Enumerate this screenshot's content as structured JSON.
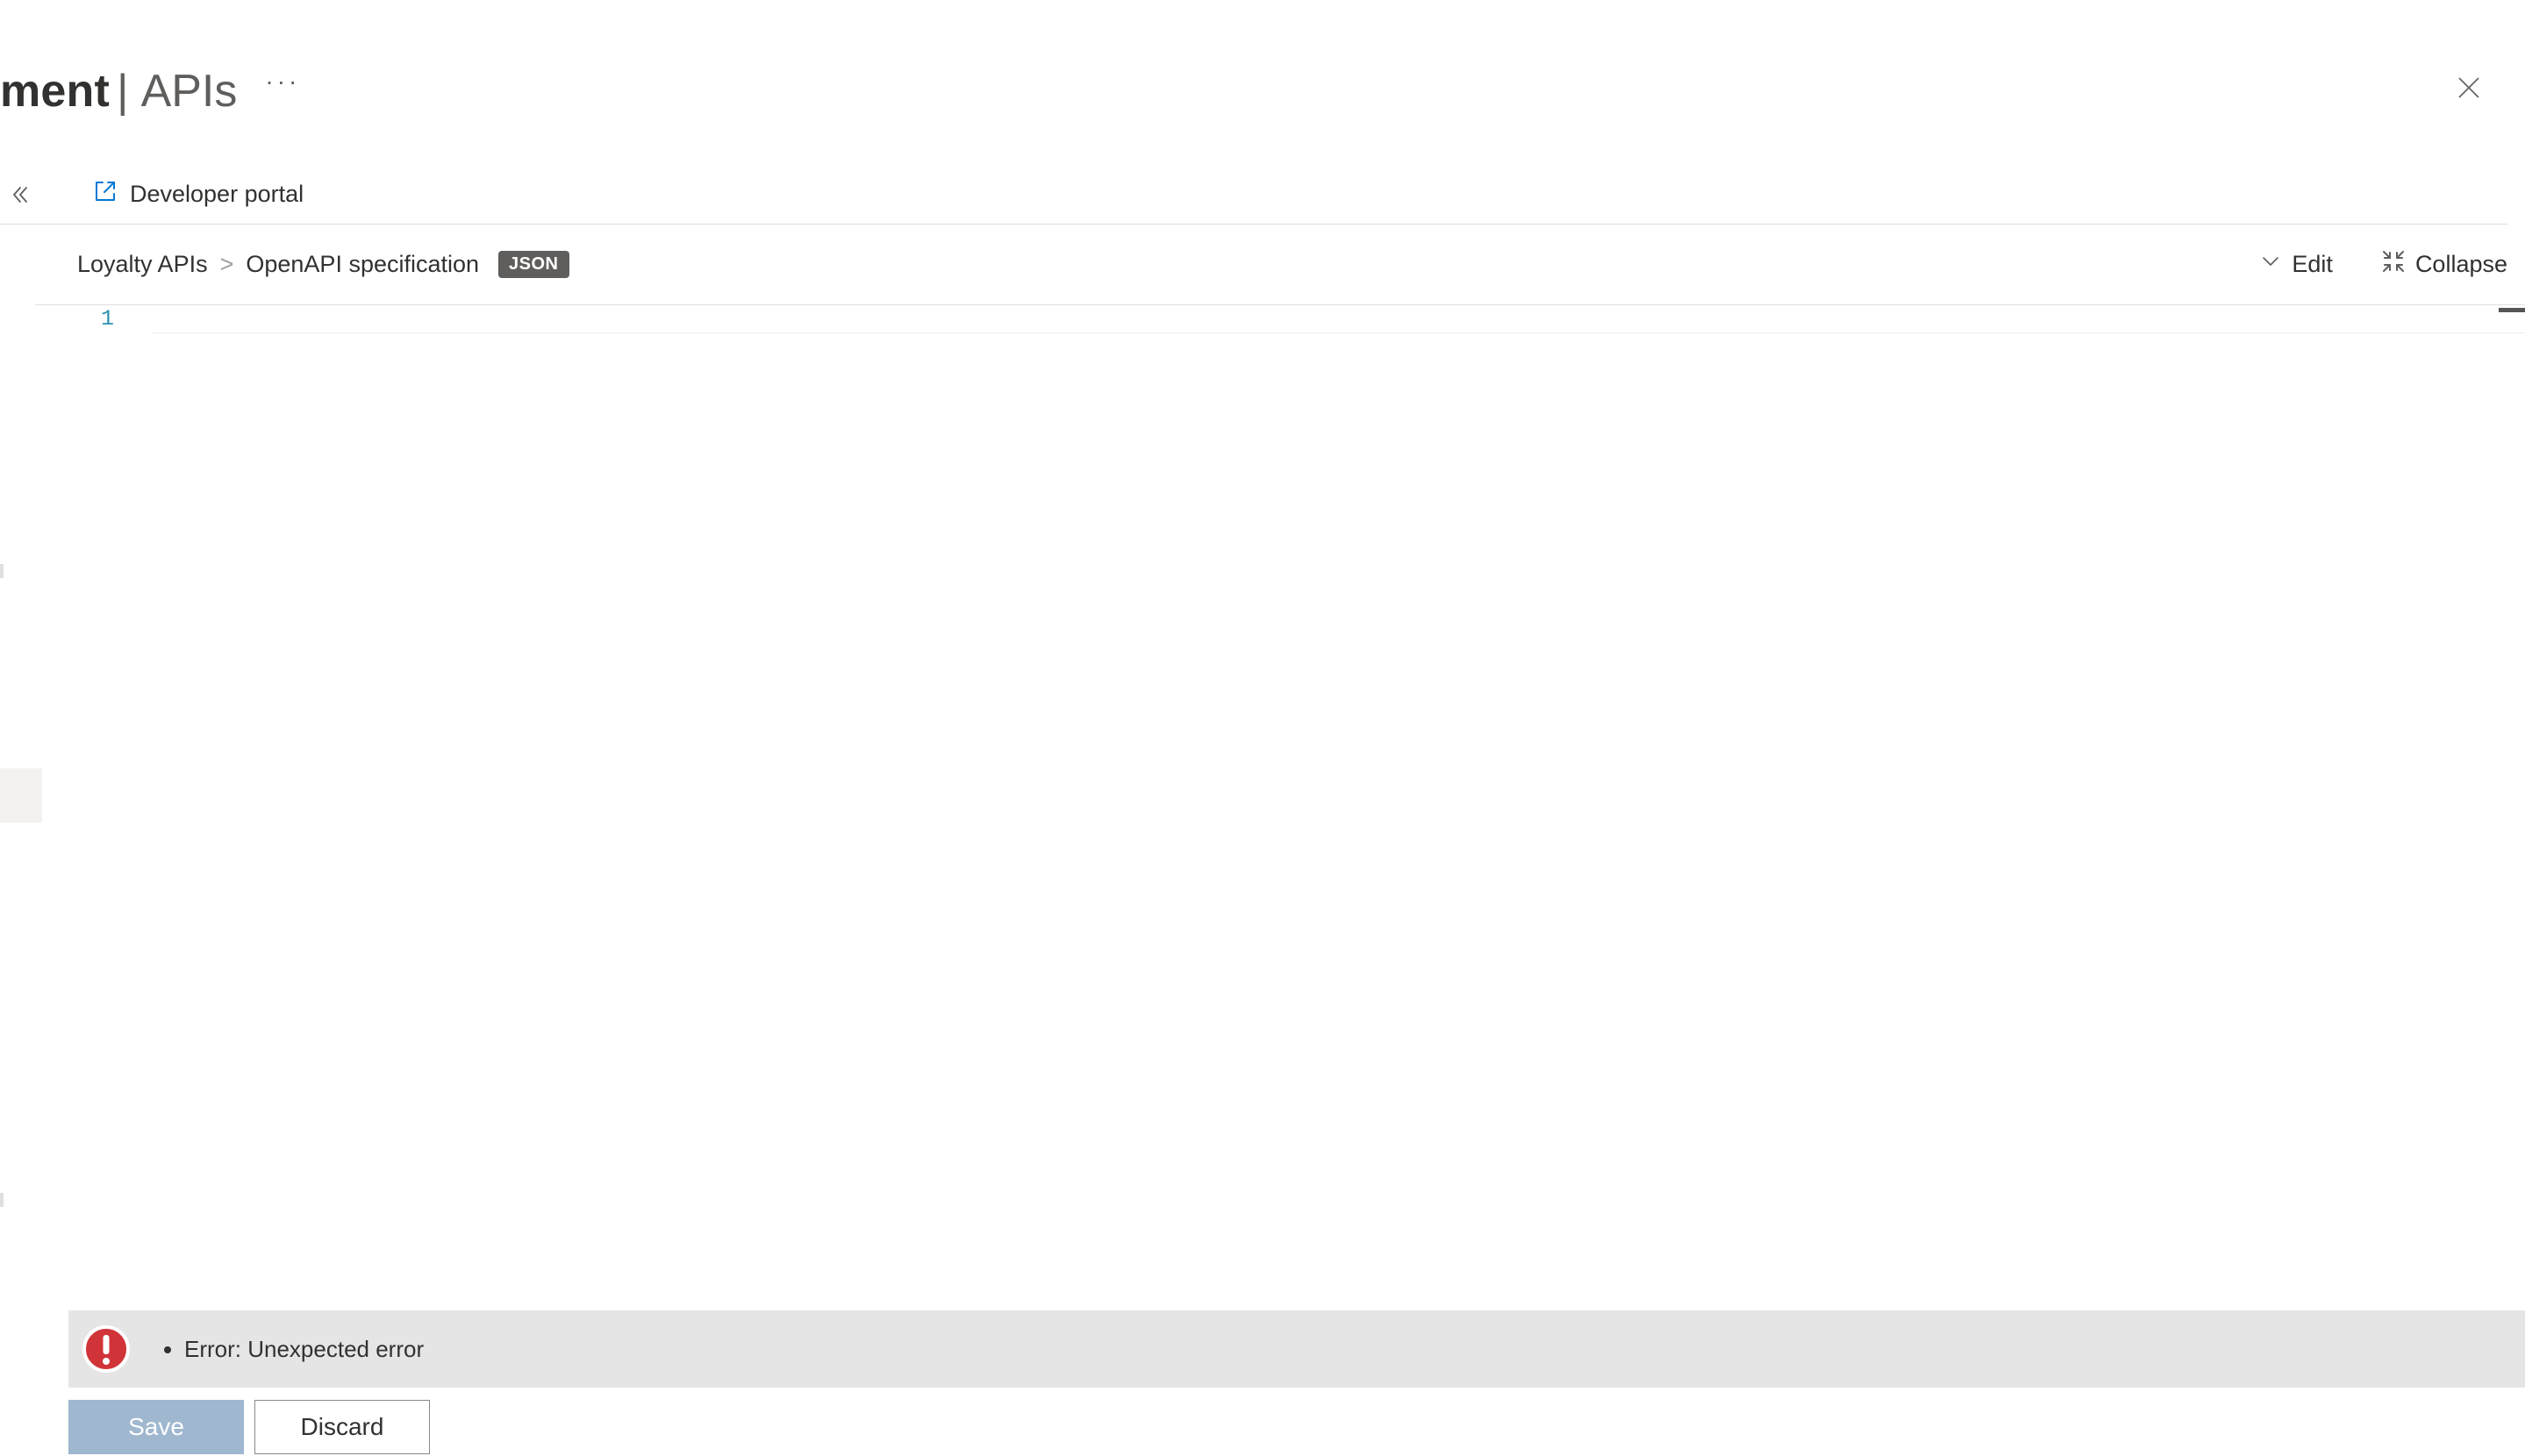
{
  "header": {
    "title_partial": "ment",
    "title_separator": "|",
    "title_section": "APIs"
  },
  "toolbar": {
    "developer_portal_label": "Developer portal"
  },
  "breadcrumb": {
    "root": "Loyalty APIs",
    "current": "OpenAPI specification",
    "badge": "JSON"
  },
  "actions": {
    "edit_label": "Edit",
    "collapse_label": "Collapse"
  },
  "editor": {
    "line_number": "1",
    "line_content": ""
  },
  "error": {
    "message": "Error: Unexpected error"
  },
  "buttons": {
    "save_label": "Save",
    "discard_label": "Discard"
  }
}
